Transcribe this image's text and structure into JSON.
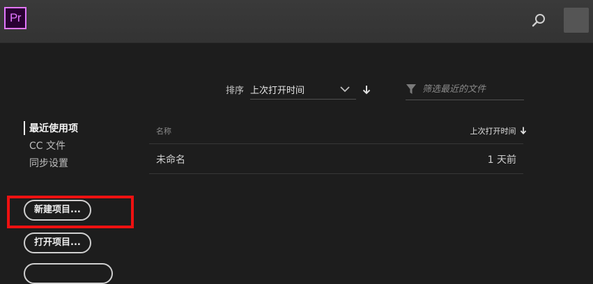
{
  "app": {
    "logo_text": "Pr"
  },
  "sort": {
    "label": "排序",
    "value": "上次打开时间"
  },
  "filter": {
    "placeholder": "筛选最近的文件"
  },
  "nav": {
    "items": [
      {
        "label": "最近使用项",
        "active": true
      },
      {
        "label": "CC 文件",
        "active": false
      },
      {
        "label": "同步设置",
        "active": false
      }
    ]
  },
  "buttons": {
    "new_project": "新建项目...",
    "open_project": "打开项目..."
  },
  "table": {
    "headers": {
      "name": "名称",
      "last_opened": "上次打开时间"
    },
    "rows": [
      {
        "name": "未命名",
        "last_opened": "1 天前"
      }
    ]
  },
  "colors": {
    "logo_accent": "#e277ff",
    "highlight": "#ee1111",
    "background": "#1d1d1d",
    "topbar": "#363636"
  }
}
